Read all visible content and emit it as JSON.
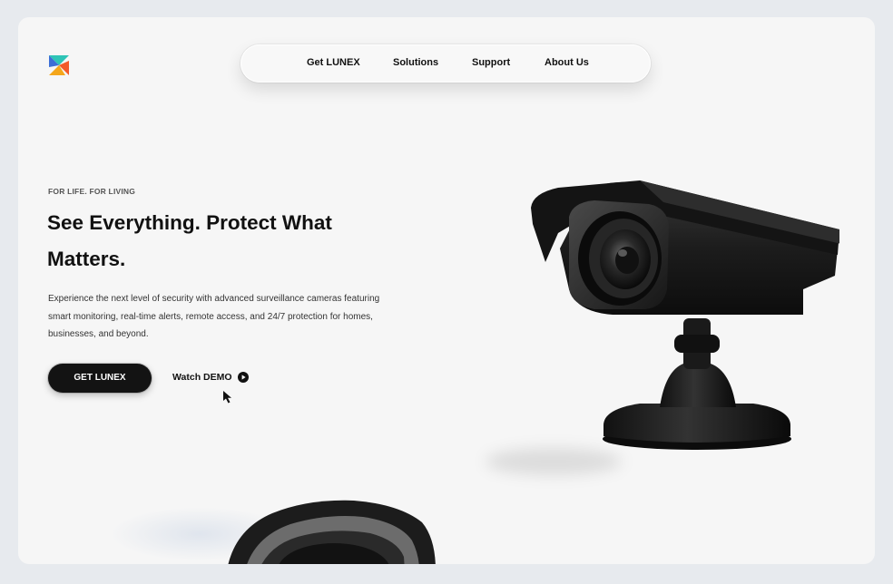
{
  "brand": {
    "logo_icon": "lunex-logo-icon",
    "colors": [
      "#2ec4b6",
      "#f4a61b",
      "#f35b2a",
      "#3b6ed6"
    ]
  },
  "nav": {
    "items": [
      {
        "label": "Get LUNEX"
      },
      {
        "label": "Solutions"
      },
      {
        "label": "Support"
      },
      {
        "label": "About Us"
      }
    ]
  },
  "hero": {
    "kicker": "FOR LIFE. FOR LIVING",
    "title": "See Everything. Protect What Matters.",
    "description": "Experience the next level of security with advanced surveillance cameras featuring smart monitoring, real-time alerts, remote access, and 24/7 protection for homes, businesses, and beyond.",
    "cta_label": "GET LUNEX",
    "demo_label": "Watch DEMO",
    "demo_icon": "play-circle-icon"
  },
  "theme": {
    "accent": "#131313",
    "background": "#f6f6f6",
    "page_bg": "#e7eaee"
  }
}
